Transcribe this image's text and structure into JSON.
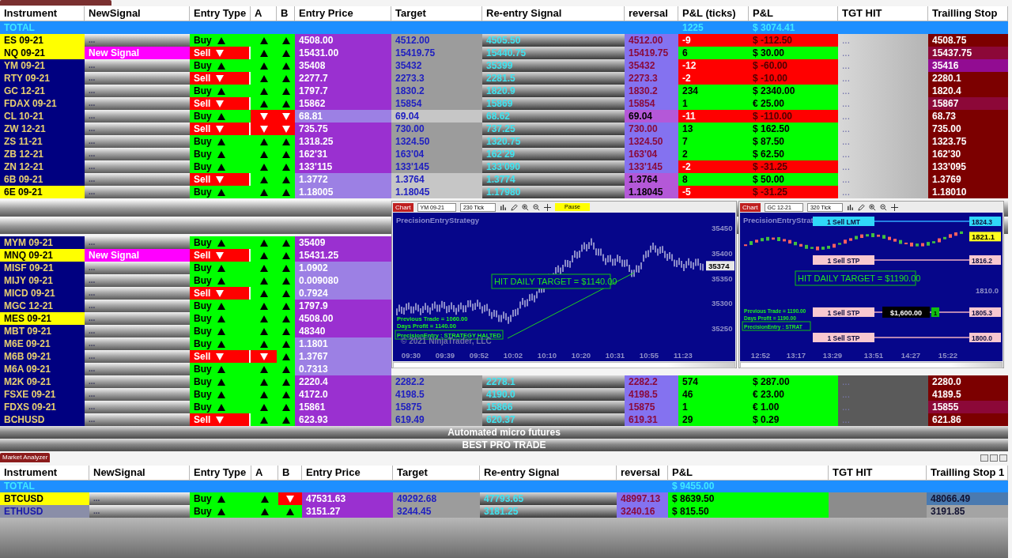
{
  "top_analyzer": {
    "columns": [
      "Instrument",
      "NewSignal",
      "Entry Type",
      "A",
      "B",
      "Entry Price",
      "Target",
      "Re-entry Signal",
      "reversal",
      "P&L (ticks)",
      "P&L",
      "TGT HIT",
      "Trailling Stop"
    ],
    "total": {
      "label": "TOTAL",
      "ticks": "1225",
      "pnl": "$ 3074.41"
    },
    "rows": [
      {
        "instrument": "ES 09-21",
        "highlight": true,
        "signal": "...",
        "new_signal": false,
        "entry": "Buy",
        "long": true,
        "a_up": true,
        "b_up": true,
        "price": "4508.00",
        "light": false,
        "target": "4512.00",
        "reentry": "4505.50",
        "reversal": "4512.00",
        "ticks": "-9",
        "pnl": "$ -112.50",
        "profit": false,
        "tgt": "...",
        "stop": "4508.75",
        "color": "#7c0000"
      },
      {
        "instrument": "NQ 09-21",
        "highlight": true,
        "signal": "New Signal",
        "new_signal": true,
        "entry": "Sell",
        "long": false,
        "a_up": true,
        "b_up": true,
        "price": "15431.00",
        "light": false,
        "target": "15419.75",
        "reentry": "15440.75",
        "reversal": "15419.75",
        "ticks": "6",
        "pnl": "$ 30.00",
        "profit": true,
        "tgt": "...",
        "stop": "15437.75",
        "color": "#8c0838"
      },
      {
        "instrument": "YM 09-21",
        "highlight": false,
        "signal": "...",
        "new_signal": false,
        "entry": "Buy",
        "long": true,
        "a_up": true,
        "b_up": true,
        "price": "35408",
        "light": false,
        "target": "35432",
        "reentry": "35399",
        "reversal": "35432",
        "ticks": "-12",
        "pnl": "$ -60.00",
        "profit": false,
        "tgt": "...",
        "stop": "35416",
        "color": "#920c92"
      },
      {
        "instrument": "RTY 09-21",
        "highlight": false,
        "signal": "...",
        "new_signal": false,
        "entry": "Sell",
        "long": false,
        "a_up": true,
        "b_up": true,
        "price": "2277.7",
        "light": false,
        "target": "2273.3",
        "reentry": "2281.5",
        "reversal": "2273.3",
        "ticks": "-2",
        "pnl": "$ -10.00",
        "profit": false,
        "tgt": "...",
        "stop": "2280.1",
        "color": "#7c0000"
      },
      {
        "instrument": "GC 12-21",
        "highlight": false,
        "signal": "...",
        "new_signal": false,
        "entry": "Buy",
        "long": true,
        "a_up": true,
        "b_up": true,
        "price": "1797.7",
        "light": false,
        "target": "1830.2",
        "reentry": "1820.9",
        "reversal": "1830.2",
        "ticks": "234",
        "pnl": "$ 2340.00",
        "profit": true,
        "tgt": "...",
        "stop": "1820.4",
        "color": "#7c0000"
      },
      {
        "instrument": "FDAX 09-21",
        "highlight": false,
        "signal": "...",
        "new_signal": false,
        "entry": "Sell",
        "long": false,
        "a_up": true,
        "b_up": true,
        "price": "15862",
        "light": false,
        "target": "15854",
        "reentry": "15869",
        "reversal": "15854",
        "ticks": "1",
        "pnl": "€ 25.00",
        "profit": true,
        "tgt": "...",
        "stop": "15867",
        "color": "#8c0838"
      },
      {
        "instrument": "CL 10-21",
        "highlight": false,
        "signal": "...",
        "new_signal": false,
        "entry": "Buy",
        "long": true,
        "a_up": false,
        "b_up": false,
        "price": "68.81",
        "light": true,
        "target": "69.04",
        "reentry": "68.62",
        "reversal": "69.04",
        "ticks": "-11",
        "pnl": "$ -110.00",
        "profit": false,
        "tgt": "...",
        "stop": "68.73",
        "color": "#7c0000"
      },
      {
        "instrument": "ZW 12-21",
        "highlight": false,
        "signal": "...",
        "new_signal": false,
        "entry": "Sell",
        "long": false,
        "a_up": false,
        "b_up": false,
        "price": "735.75",
        "light": false,
        "target": "730.00",
        "reentry": "737.25",
        "reversal": "730.00",
        "ticks": "13",
        "pnl": "$ 162.50",
        "profit": true,
        "tgt": "...",
        "stop": "735.00",
        "color": "#7c0000"
      },
      {
        "instrument": "ZS 11-21",
        "highlight": false,
        "signal": "...",
        "new_signal": false,
        "entry": "Buy",
        "long": true,
        "a_up": true,
        "b_up": true,
        "price": "1318.25",
        "light": false,
        "target": "1324.50",
        "reentry": "1320.75",
        "reversal": "1324.50",
        "ticks": "7",
        "pnl": "$ 87.50",
        "profit": true,
        "tgt": "...",
        "stop": "1323.75",
        "color": "#7c0000"
      },
      {
        "instrument": "ZB 12-21",
        "highlight": false,
        "signal": "...",
        "new_signal": false,
        "entry": "Buy",
        "long": true,
        "a_up": true,
        "b_up": true,
        "price": "162'31",
        "light": false,
        "target": "163'04",
        "reentry": "162'29",
        "reversal": "163'04",
        "ticks": "2",
        "pnl": "$ 62.50",
        "profit": true,
        "tgt": "...",
        "stop": "162'30",
        "color": "#7c0000"
      },
      {
        "instrument": "ZN 12-21",
        "highlight": false,
        "signal": "...",
        "new_signal": false,
        "entry": "Buy",
        "long": true,
        "a_up": true,
        "b_up": true,
        "price": "133'115",
        "light": false,
        "target": "133'145",
        "reentry": "133'090",
        "reversal": "133'145",
        "ticks": "-2",
        "pnl": "$ -31.25",
        "profit": false,
        "tgt": "...",
        "stop": "133'095",
        "color": "#7c0000"
      },
      {
        "instrument": "6B 09-21",
        "highlight": false,
        "signal": "...",
        "new_signal": false,
        "entry": "Sell",
        "long": false,
        "a_up": true,
        "b_up": true,
        "price": "1.3772",
        "light": true,
        "target": "1.3764",
        "reentry": "1.3774",
        "reversal": "1.3764",
        "ticks": "8",
        "pnl": "$ 50.00",
        "profit": true,
        "tgt": "...",
        "stop": "1.3769",
        "color": "#7c0000"
      },
      {
        "instrument": "6E 09-21",
        "highlight": true,
        "signal": "...",
        "new_signal": false,
        "entry": "Buy",
        "long": true,
        "a_up": true,
        "b_up": true,
        "price": "1.18005",
        "light": true,
        "target": "1.18045",
        "reentry": "1.17980",
        "reversal": "1.18045",
        "ticks": "-5",
        "pnl": "$ -31.25",
        "profit": false,
        "tgt": "...",
        "stop": "1.18010",
        "color": "#7c0000"
      }
    ],
    "lower_rows": [
      {
        "instrument": "MYM 09-21",
        "highlight": false,
        "signal": "...",
        "new_signal": false,
        "entry": "Buy",
        "long": true,
        "a_up": true,
        "b_up": true,
        "price": "35409",
        "light": false
      },
      {
        "instrument": "MNQ 09-21",
        "highlight": true,
        "signal": "New Signal",
        "new_signal": true,
        "entry": "Sell",
        "long": false,
        "a_up": true,
        "b_up": true,
        "price": "15431.25",
        "light": false
      },
      {
        "instrument": "MISF 09-21",
        "highlight": false,
        "signal": "...",
        "new_signal": false,
        "entry": "Buy",
        "long": true,
        "a_up": true,
        "b_up": true,
        "price": "1.0902",
        "light": true
      },
      {
        "instrument": "MIJY 09-21",
        "highlight": false,
        "signal": "...",
        "new_signal": false,
        "entry": "Buy",
        "long": true,
        "a_up": true,
        "b_up": true,
        "price": "0.009080",
        "light": true
      },
      {
        "instrument": "MICD 09-21",
        "highlight": false,
        "signal": "...",
        "new_signal": false,
        "entry": "Sell",
        "long": false,
        "a_up": true,
        "b_up": true,
        "price": "0.7924",
        "light": true
      },
      {
        "instrument": "MGC 12-21",
        "highlight": false,
        "signal": "...",
        "new_signal": false,
        "entry": "Buy",
        "long": true,
        "a_up": true,
        "b_up": true,
        "price": "1797.9",
        "light": false
      },
      {
        "instrument": "MES 09-21",
        "highlight": true,
        "signal": "...",
        "new_signal": false,
        "entry": "Buy",
        "long": true,
        "a_up": true,
        "b_up": true,
        "price": "4508.00",
        "light": false
      },
      {
        "instrument": "MBT 09-21",
        "highlight": false,
        "signal": "...",
        "new_signal": false,
        "entry": "Buy",
        "long": true,
        "a_up": true,
        "b_up": true,
        "price": "48340",
        "light": false
      },
      {
        "instrument": "M6E 09-21",
        "highlight": false,
        "signal": "...",
        "new_signal": false,
        "entry": "Buy",
        "long": true,
        "a_up": true,
        "b_up": true,
        "price": "1.1801",
        "light": true
      },
      {
        "instrument": "M6B 09-21",
        "highlight": false,
        "signal": "...",
        "new_signal": false,
        "entry": "Sell",
        "long": false,
        "a_up": false,
        "b_up": true,
        "price": "1.3767",
        "light": true
      },
      {
        "instrument": "M6A 09-21",
        "highlight": false,
        "signal": "...",
        "new_signal": false,
        "entry": "Buy",
        "long": true,
        "a_up": true,
        "b_up": true,
        "price": "0.7313",
        "light": true
      },
      {
        "instrument": "M2K 09-21",
        "highlight": false,
        "signal": "...",
        "new_signal": false,
        "entry": "Buy",
        "long": true,
        "a_up": true,
        "b_up": true,
        "price": "2220.4",
        "light": false,
        "target": "2282.2",
        "reentry": "2278.1",
        "reversal": "2282.2",
        "ticks": "574",
        "pnl": "$ 287.00",
        "profit": true,
        "tgt": "...",
        "stop": "2280.0",
        "color": "#7c0000"
      },
      {
        "instrument": "FSXE 09-21",
        "highlight": false,
        "signal": "...",
        "new_signal": false,
        "entry": "Buy",
        "long": true,
        "a_up": true,
        "b_up": true,
        "price": "4172.0",
        "light": false,
        "target": "4198.5",
        "reentry": "4190.0",
        "reversal": "4198.5",
        "ticks": "46",
        "pnl": "€ 23.00",
        "profit": true,
        "tgt": "...",
        "stop": "4189.5",
        "color": "#7c0000"
      },
      {
        "instrument": "FDXS 09-21",
        "highlight": false,
        "signal": "...",
        "new_signal": false,
        "entry": "Buy",
        "long": true,
        "a_up": true,
        "b_up": true,
        "price": "15861",
        "light": false,
        "target": "15875",
        "reentry": "15866",
        "reversal": "15875",
        "ticks": "1",
        "pnl": "€ 1.00",
        "profit": true,
        "tgt": "...",
        "stop": "15855",
        "color": "#8c0838"
      },
      {
        "instrument": "BCHUSD",
        "highlight": false,
        "signal": "...",
        "new_signal": false,
        "entry": "Sell",
        "long": false,
        "a_up": true,
        "b_up": true,
        "price": "623.93",
        "light": false,
        "target": "619.49",
        "reentry": "620.37",
        "reversal": "619.31",
        "ticks": "29",
        "pnl": "$ 0.29",
        "profit": true,
        "tgt": "...",
        "stop": "621.86",
        "color": "#7c0000"
      }
    ]
  },
  "banners": [
    "Automated micro futures",
    "BEST PRO TRADE"
  ],
  "charts": [
    {
      "tab": "Chart",
      "instrument": "YM 09-21",
      "interval": "230 Tick",
      "pause": "Pause",
      "title": "PrecisionEntryStrategy",
      "y_labels": [
        "35450",
        "35400",
        "35350",
        "35300",
        "35250"
      ],
      "price_tag": "35374",
      "target_note": "HIT DAILY TARGET = $1140.00",
      "notes": [
        "Previous Trade = 1060.00",
        "Days Profit = 1140.00"
      ],
      "status": "PrecisionEntry : STRATEGY HALTED",
      "copyright": "© 2021 NinjaTrader, LLC",
      "x_labels": [
        "09:30",
        "09:39",
        "09:52",
        "10:02",
        "10:10",
        "10:20",
        "10:31",
        "10:55",
        "11:23"
      ]
    },
    {
      "tab": "Chart",
      "instrument": "GC 12-21",
      "interval": "320 Tick",
      "title": "PrecisionEntryStrat",
      "y_labels": [
        "1810.0"
      ],
      "price_tag": "1821.1",
      "target_note": "HIT DAILY TARGET = $1190.00",
      "notes": [
        "Previous Trade = 1190.00",
        "Days Profit = 1190.00"
      ],
      "status": "PrecisionEntry : STRAT",
      "x_labels": [
        "12:52",
        "13:17",
        "13:29",
        "13:51",
        "14:27",
        "15:22"
      ],
      "orders": [
        {
          "label": "1 Sell LMT",
          "price": "1824.3",
          "kind": "limit"
        },
        {
          "label": "1 Sell STP",
          "price": "1816.2",
          "kind": "stop"
        },
        {
          "label": "1 Sell STP",
          "price": "1805.3",
          "kind": "stop",
          "pnl": "$1,600.00",
          "qty": "1"
        },
        {
          "label": "1 Sell STP",
          "price": "1800.0",
          "kind": "stop"
        }
      ]
    }
  ],
  "bottom_analyzer": {
    "title": "Market Analyzer",
    "columns": [
      "Instrument",
      "NewSignal",
      "Entry Type",
      "A",
      "B",
      "Entry Price",
      "Target",
      "Re-entry Signal",
      "reversal",
      "P&L",
      "TGT HIT",
      "Trailling Stop 1"
    ],
    "total": {
      "label": "TOTAL",
      "pnl": "$ 9455.00"
    },
    "rows": [
      {
        "instrument": "BTCUSD",
        "highlight": true,
        "muted": false,
        "signal": "...",
        "new_signal": false,
        "entry": "Buy",
        "long": true,
        "a_up": true,
        "b_up": false,
        "price": "47531.63",
        "light": false,
        "target": "49292.68",
        "reentry": "47793.65",
        "reversal": "48997.13",
        "pnl": "$ 8639.50",
        "profit": true,
        "stop": "48066.49",
        "color": "#4a7ab0"
      },
      {
        "instrument": "ETHUSD",
        "highlight": false,
        "muted": true,
        "signal": "...",
        "new_signal": false,
        "entry": "Buy",
        "long": true,
        "a_up": true,
        "b_up": true,
        "price": "3151.27",
        "light": false,
        "target": "3244.45",
        "reentry": "3181.25",
        "reversal": "3240.16",
        "pnl": "$ 815.50",
        "profit": true,
        "stop": "3191.85",
        "color": "#a4a4a4"
      }
    ]
  }
}
